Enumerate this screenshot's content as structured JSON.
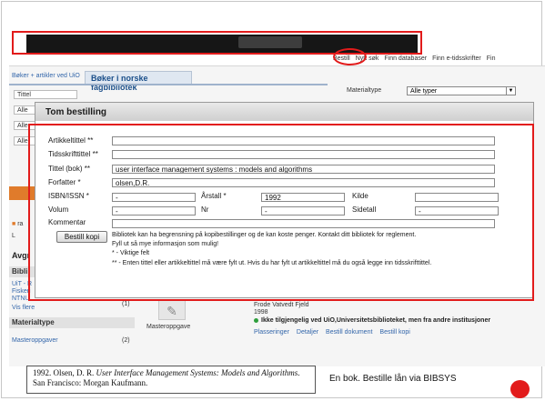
{
  "topnav": {
    "items": [
      "Bestill",
      "Nytt søk",
      "Finn databaser",
      "Finn e-tidsskrifter",
      "Fin"
    ]
  },
  "search": {
    "crumb": "Bøker + artikler ved UiO",
    "tab_active": "Bøker i norske fagbibliotek",
    "materialtype_label": "Materialtype",
    "materialtype_value": "Alle typer",
    "ghost_rows": [
      "Tittel",
      "Alle",
      "Alle",
      "Alle"
    ]
  },
  "sidebar": {
    "frag1": "ra",
    "frag2": "L",
    "heading": "Avgr",
    "section1": "Bibli",
    "lines": [
      "UiT - R",
      "Fiskeri",
      "NTNU"
    ],
    "vis_flere": "Vis flere",
    "count": "(1)",
    "section2": "Materialtype",
    "mtype_item": "Masteroppgaver",
    "mtype_count": "(2)"
  },
  "result": {
    "author": "Frode Vatvedt Fjeld",
    "year": "1998",
    "status": "Ikke tilgjengelig ved UiO,Universitetsbiblioteket, men fra andre institusjoner",
    "type_label": "Masteroppgave",
    "links": [
      "Plasseringer",
      "Detaljer",
      "Bestill dokument",
      "Bestill kopi"
    ]
  },
  "dialog": {
    "title": "Tom bestilling",
    "fields": {
      "artikkeltittel": {
        "label": "Artikkeltittel **",
        "value": ""
      },
      "tidsskrifttittel": {
        "label": "Tidsskrifttittel **",
        "value": ""
      },
      "tittel_bok": {
        "label": "Tittel (bok) **",
        "value": "user interface management systems : models and algorithms"
      },
      "forfatter": {
        "label": "Forfatter *",
        "value": "olsen,D.R."
      },
      "isbn": {
        "label": "ISBN/ISSN *",
        "value": "-"
      },
      "arstall": {
        "label": "Årstall *",
        "value": "1992"
      },
      "kilde": {
        "label": "Kilde",
        "value": ""
      },
      "volum": {
        "label": "Volum",
        "value": "-"
      },
      "nr": {
        "label": "Nr",
        "value": "-"
      },
      "sidetall": {
        "label": "Sidetall",
        "value": "-"
      },
      "kommentar": {
        "label": "Kommentar",
        "value": ""
      }
    },
    "order_button": "Bestill kopi",
    "notes": [
      "Bibliotek kan ha begrensning på kopibestillinger og de kan koste penger. Kontakt ditt bibliotek for reglement.",
      "Fyll ut så mye informasjon som mulig!",
      "* - Viktige felt",
      "** - Enten tittel eller artikkeltittel må være fylt ut. Hvis du har fylt ut artikkeltittel må du også legge inn tidsskrifttittel."
    ]
  },
  "citation": {
    "prefix": "1992. Olsen, D. R. ",
    "title": "User Interface Management Systems: Models and Algorithms",
    "suffix": ".  San Francisco: Morgan Kaufmann."
  },
  "caption": "En bok. Bestille lån via BIBSYS",
  "colors": {
    "highlight_red": "#e21b1b",
    "link_blue": "#3366aa",
    "status_green": "#2d9e3c"
  }
}
